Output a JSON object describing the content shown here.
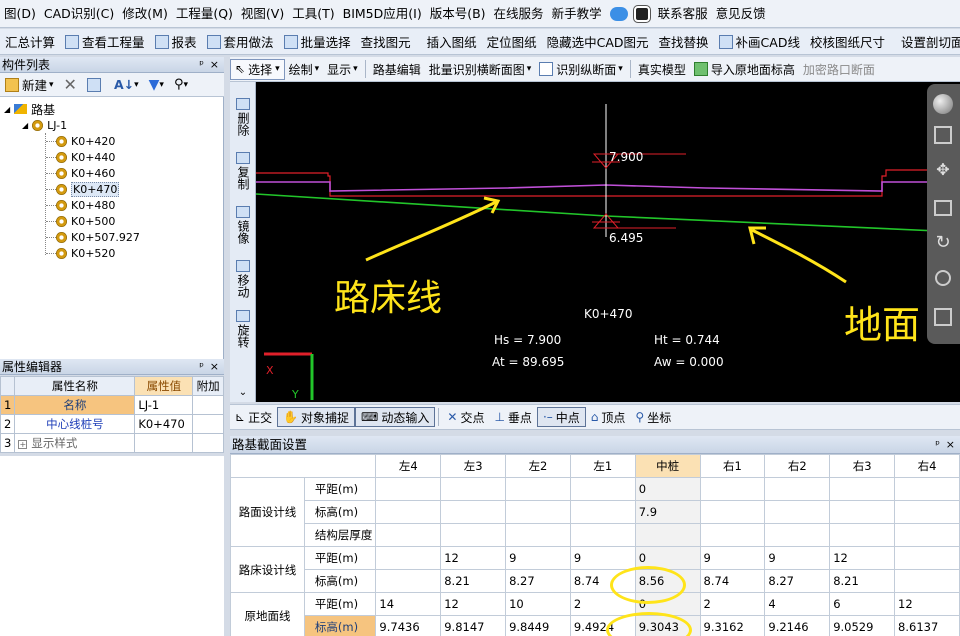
{
  "menubar": {
    "items": [
      "图(D)",
      "CAD识别(C)",
      "修改(M)",
      "工程量(Q)",
      "视图(V)",
      "工具(T)",
      "BIM5D应用(I)",
      "版本号(B)",
      "在线服务",
      "新手教学",
      "联系客服",
      "意见反馈"
    ]
  },
  "toolbar1": {
    "items": [
      "汇总计算",
      "查看工程量",
      "报表",
      "套用做法",
      "批量选择",
      "查找图元",
      "插入图纸",
      "定位图纸",
      "隐藏选中CAD图元",
      "查找替换",
      "补画CAD线",
      "校核图纸尺寸",
      "设置剖切面"
    ]
  },
  "component_list": {
    "title": "构件列表",
    "new_label": "新建",
    "root": "路基",
    "group": "LJ-1",
    "stations": [
      "K0+420",
      "K0+440",
      "K0+460",
      "K0+470",
      "K0+480",
      "K0+500",
      "K0+507.927",
      "K0+520"
    ],
    "selected": "K0+470"
  },
  "property_editor": {
    "title": "属性编辑器",
    "headers": [
      "属性名称",
      "属性值",
      "附加"
    ],
    "rows": [
      {
        "no": "1",
        "name": "名称",
        "value": "LJ-1"
      },
      {
        "no": "2",
        "name": "中心线桩号",
        "value": "K0+470"
      },
      {
        "no": "3",
        "name": "显示样式",
        "value": ""
      }
    ]
  },
  "cad_toolbar": {
    "items": [
      "选择",
      "绘制",
      "显示",
      "路基编辑",
      "批量识别横断面图",
      "识别纵断面",
      "真实模型",
      "导入原地面标高",
      "加密路口断面"
    ]
  },
  "vertical_tools": [
    "删除",
    "复制",
    "镜像",
    "移动",
    "旋转"
  ],
  "canvas": {
    "top_elev": "7.900",
    "bottom_elev": "6.495",
    "station": "K0+470",
    "hs": "Hs = 7.900",
    "ht": "Ht = 0.744",
    "at": "At = 89.695",
    "aw": "Aw = 0.000",
    "label_subgrade": "路床线",
    "label_ground": "地面",
    "axis_x": "X",
    "axis_y": "Y"
  },
  "snapbar": {
    "items": [
      "正交",
      "对象捕捉",
      "动态输入",
      "交点",
      "垂点",
      "中点",
      "顶点",
      "坐标"
    ]
  },
  "section_settings": {
    "title": "路基截面设置",
    "columns": [
      "左4",
      "左3",
      "左2",
      "左1",
      "中桩",
      "右1",
      "右2",
      "右3",
      "右4"
    ],
    "groups": [
      {
        "name": "路面设计线",
        "rows": [
          {
            "label": "平距(m)",
            "values": [
              "",
              "",
              "",
              "",
              "0",
              "",
              "",
              "",
              ""
            ]
          },
          {
            "label": "标高(m)",
            "values": [
              "",
              "",
              "",
              "",
              "7.9",
              "",
              "",
              "",
              ""
            ]
          },
          {
            "label": "结构层厚度",
            "values": [
              "",
              "",
              "",
              "",
              "",
              "",
              "",
              "",
              ""
            ]
          }
        ]
      },
      {
        "name": "路床设计线",
        "rows": [
          {
            "label": "平距(m)",
            "values": [
              "",
              "12",
              "9",
              "9",
              "0",
              "9",
              "9",
              "12",
              ""
            ]
          },
          {
            "label": "标高(m)",
            "values": [
              "",
              "8.21",
              "8.27",
              "8.74",
              "8.56",
              "8.74",
              "8.27",
              "8.21",
              ""
            ]
          }
        ]
      },
      {
        "name": "原地面线",
        "rows": [
          {
            "label": "平距(m)",
            "values": [
              "14",
              "12",
              "10",
              "2",
              "0",
              "2",
              "4",
              "6",
              "12"
            ]
          },
          {
            "label": "标高(m)",
            "values": [
              "9.7436",
              "9.8147",
              "9.8449",
              "9.4924",
              "9.3043",
              "9.3162",
              "9.2146",
              "9.0529",
              "8.6137"
            ]
          }
        ]
      }
    ]
  }
}
